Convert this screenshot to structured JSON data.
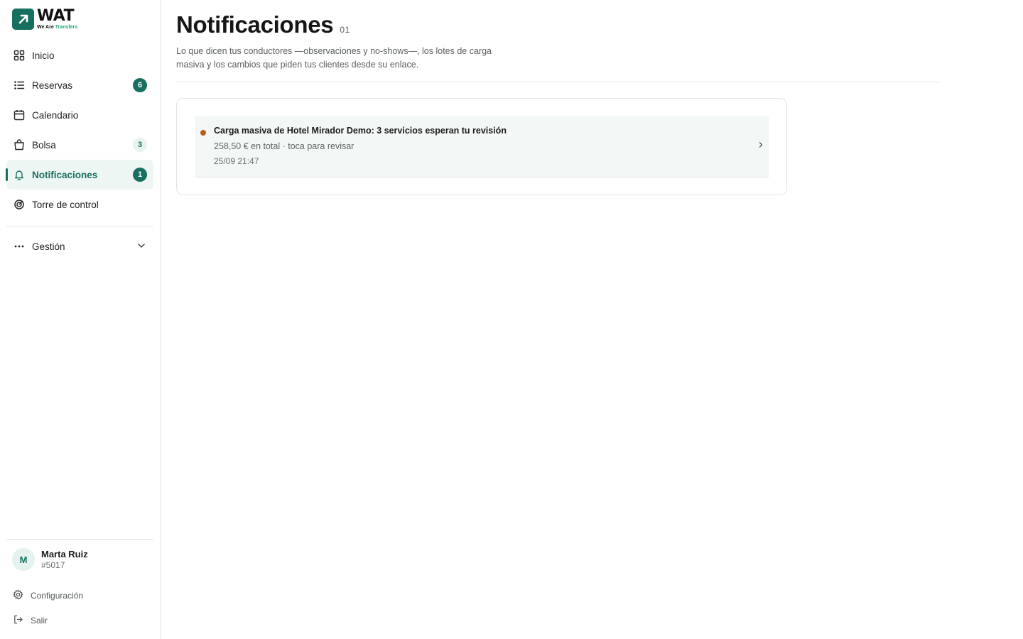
{
  "brand": {
    "name": "WAT",
    "tagline_a": "We Are ",
    "tagline_b": "Transfers"
  },
  "nav": [
    {
      "label": "Inicio",
      "icon": "grid-icon"
    },
    {
      "label": "Reservas",
      "icon": "list-icon",
      "badge": "6"
    },
    {
      "label": "Calendario",
      "icon": "calendar-icon"
    },
    {
      "label": "Bolsa",
      "icon": "bag-icon",
      "badge": "3"
    },
    {
      "label": "Notificaciones",
      "icon": "bell-icon",
      "badge": "1",
      "active": true
    },
    {
      "label": "Torre de control",
      "icon": "target-icon"
    }
  ],
  "gestion": {
    "label": "Gestión"
  },
  "user": {
    "initial": "M",
    "name": "Marta Ruiz",
    "id": "#5017"
  },
  "footer": {
    "settings": "Configuración",
    "logout": "Salir"
  },
  "page": {
    "title": "Notificaciones",
    "count": "01",
    "subtitle": "Lo que dicen tus conductores —observaciones y no-shows—, los lotes de carga masiva y los cambios que piden tus clientes desde su enlace."
  },
  "notifications": [
    {
      "title": "Carga masiva de Hotel Mirador Demo: 3 servicios esperan tu revisión",
      "subtitle": "258,50 € en total · toca para revisar",
      "time": "25/09 21:47"
    }
  ],
  "colors": {
    "accent": "#17705f",
    "unread": "#b6601b"
  }
}
